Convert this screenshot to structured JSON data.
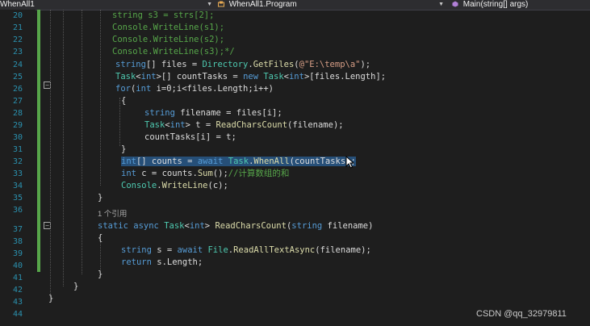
{
  "navbar": {
    "project": "WhenAll1",
    "class": "WhenAll1.Program",
    "member": "Main(string[] args)"
  },
  "editor": {
    "line_numbers": [
      "20",
      "21",
      "22",
      "23",
      "24",
      "25",
      "26",
      "27",
      "28",
      "29",
      "30",
      "31",
      "32",
      "33",
      "34",
      "35",
      "36",
      "37",
      "38",
      "39",
      "40",
      "41",
      "42",
      "43",
      "44"
    ],
    "code_lens": "1 个引用",
    "selection": "int[] counts = await Task.WhenAll(countTasks);"
  },
  "watermark": "CSDN @qq_32979811"
}
